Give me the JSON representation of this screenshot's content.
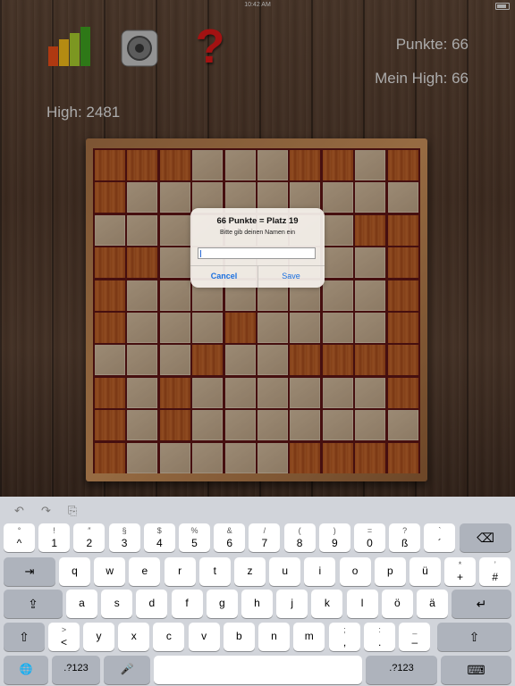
{
  "status": {
    "time": "10:42 AM"
  },
  "hud": {
    "punkte": "Punkte: 66",
    "mein_high": "Mein High: 66",
    "high": "High: 2481",
    "help_glyph": "?"
  },
  "icons": {
    "chart": "bar-chart-icon",
    "sound": "speaker-icon",
    "help": "question-mark-icon"
  },
  "colors": {
    "help": "#d01818",
    "dialog_button": "#1a6fe0",
    "board_border": "#5a1414"
  },
  "board": {
    "rows": 10,
    "cols": 10,
    "cells": [
      "WWWLLLWWLW",
      "WLLLLLLLLL",
      "LLLLLLLLWW",
      "WWLLLLLLLW",
      "WLLLLLLLLW",
      "WLLLWLLLLW",
      "LLLWLLWWWW",
      "WLWLLLLLLW",
      "WLWLLLLLLL",
      "WLLLLLWWWW"
    ]
  },
  "dialog": {
    "title": "66 Punkte = Platz 19",
    "message": "Bitte gib deinen Namen ein",
    "input_value": "",
    "cancel_label": "Cancel",
    "save_label": "Save"
  },
  "keyboard": {
    "toolbar": {
      "undo": "↶",
      "redo": "↷",
      "paste": "⎘"
    },
    "row1": [
      {
        "alt": "°",
        "main": "^"
      },
      {
        "alt": "!",
        "main": "1"
      },
      {
        "alt": "″",
        "main": "2"
      },
      {
        "alt": "§",
        "main": "3"
      },
      {
        "alt": "$",
        "main": "4"
      },
      {
        "alt": "%",
        "main": "5"
      },
      {
        "alt": "&",
        "main": "6"
      },
      {
        "alt": "/",
        "main": "7"
      },
      {
        "alt": "(",
        "main": "8"
      },
      {
        "alt": ")",
        "main": "9"
      },
      {
        "alt": "=",
        "main": "0"
      },
      {
        "alt": "?",
        "main": "ß"
      },
      {
        "alt": "`",
        "main": "´"
      }
    ],
    "backspace": "⌫",
    "tab": "⇥",
    "row2": [
      "q",
      "w",
      "e",
      "r",
      "t",
      "z",
      "u",
      "i",
      "o",
      "p",
      "ü"
    ],
    "row2_extra": [
      {
        "alt": "*",
        "main": "+"
      },
      {
        "alt": "’",
        "main": "#"
      }
    ],
    "caps": "⇪",
    "row3": [
      "a",
      "s",
      "d",
      "f",
      "g",
      "h",
      "j",
      "k",
      "l",
      "ö",
      "ä"
    ],
    "return": "↵",
    "shift": "⇧",
    "row4_first": {
      "alt": ">",
      "main": "<"
    },
    "row4": [
      "y",
      "x",
      "c",
      "v",
      "b",
      "n",
      "m"
    ],
    "row4_punct": [
      {
        "alt": ";",
        "main": ","
      },
      {
        "alt": ":",
        "main": "."
      },
      {
        "alt": "_",
        "main": "–"
      }
    ],
    "globe": "🌐",
    "num_label": ".?123",
    "mic": "🎤",
    "hide": "⌨"
  }
}
